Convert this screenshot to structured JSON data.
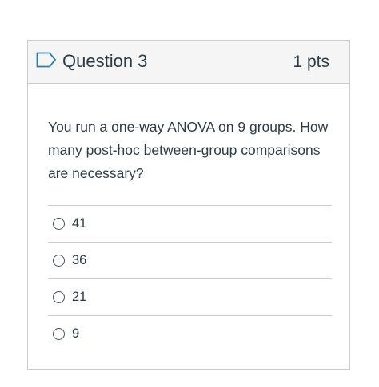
{
  "question": {
    "title": "Question 3",
    "points": "1 pts",
    "flag_icon": "flag-outline-icon",
    "text": "You run a one-way ANOVA on 9 groups. How many post-hoc between-group comparisons are necessary?",
    "answers": [
      {
        "label": "41",
        "selected": false
      },
      {
        "label": "36",
        "selected": false
      },
      {
        "label": "21",
        "selected": false
      },
      {
        "label": "9",
        "selected": false
      }
    ]
  },
  "colors": {
    "header_bg": "#f5f5f5",
    "border": "#c7cdd1",
    "text": "#2d3b45",
    "flag": "#2a7ab8"
  }
}
